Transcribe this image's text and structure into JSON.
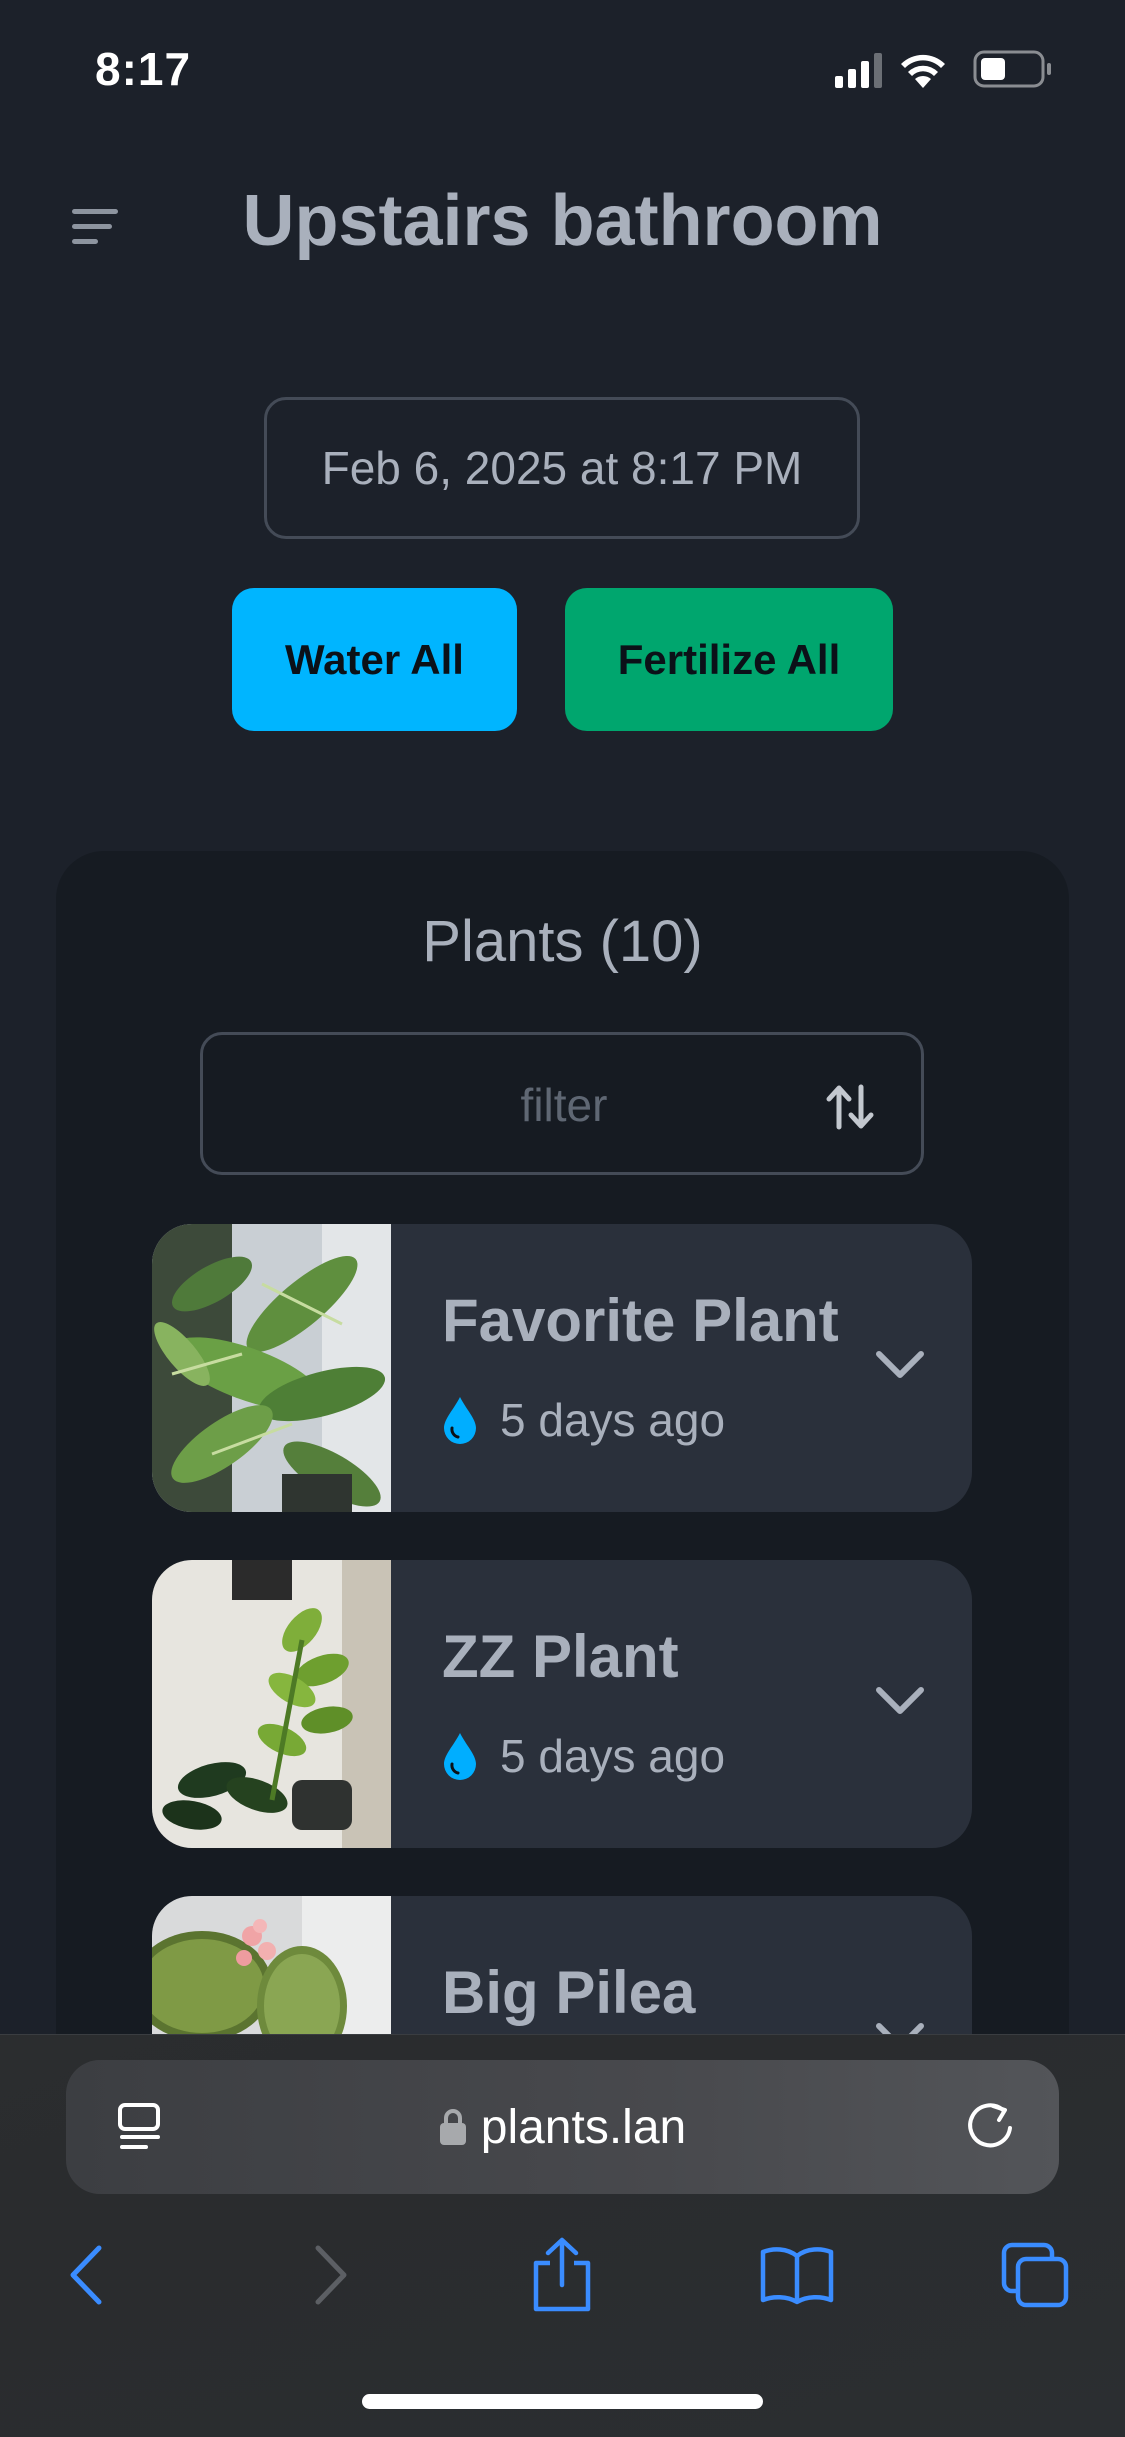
{
  "status_bar": {
    "time": "8:17"
  },
  "header": {
    "title": "Upstairs bathroom",
    "menu_icon": "menu-icon"
  },
  "date_field": {
    "value": "Feb 6, 2025 at 8:17 PM"
  },
  "actions": {
    "water_all_label": "Water All",
    "fertilize_all_label": "Fertilize All",
    "water_color": "#00b5ff",
    "fertilize_color": "#00a66e"
  },
  "plants": {
    "heading": "Plants (10)",
    "filter_placeholder": "filter",
    "sort_icon": "sort-arrows-icon",
    "items": [
      {
        "name": "Favorite Plant",
        "last_watered": "5 days ago"
      },
      {
        "name": "ZZ Plant",
        "last_watered": "5 days ago"
      },
      {
        "name": "Big Pilea",
        "last_watered": ""
      }
    ]
  },
  "browser": {
    "url": "plants.lan",
    "accent_color": "#3a8cff",
    "icons": [
      "reader-icon",
      "lock-icon",
      "reload-icon",
      "back-icon",
      "forward-icon",
      "share-icon",
      "bookmarks-icon",
      "tabs-icon"
    ]
  }
}
